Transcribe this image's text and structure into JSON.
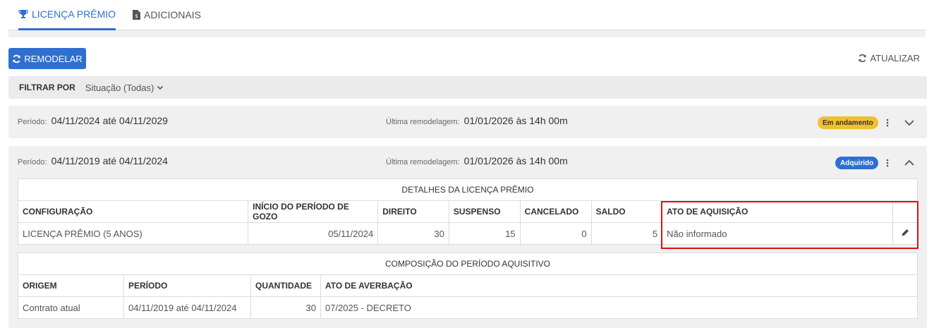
{
  "tabs": [
    {
      "label": "LICENÇA PRÊMIO",
      "icon": "trophy-icon",
      "active": true
    },
    {
      "label": "ADICIONAIS",
      "icon": "document-money-icon",
      "active": false
    }
  ],
  "toolbar": {
    "remodel_label": "REMODELAR",
    "refresh_label": "ATUALIZAR"
  },
  "filter": {
    "label": "FILTRAR POR",
    "value": "Situação (Todas)"
  },
  "periods": [
    {
      "period_label": "Período:",
      "period_value": "04/11/2024 até 04/11/2029",
      "remodel_label": "Última remodelagem:",
      "remodel_value": "01/01/2026 às 14h 00m",
      "status": "Em andamento",
      "status_color": "#f0c030",
      "expanded": false
    },
    {
      "period_label": "Período:",
      "period_value": "04/11/2019 até 04/11/2024",
      "remodel_label": "Última remodelagem:",
      "remodel_value": "01/01/2026 às 14h 00m",
      "status": "Adquirido",
      "status_color": "#2f6fd0",
      "expanded": true,
      "details": {
        "title": "DETALHES DA LICENÇA PRÊMIO",
        "headers": [
          "CONFIGURAÇÃO",
          "INÍCIO DO PERÍODO DE GOZO",
          "DIREITO",
          "SUSPENSO",
          "CANCELADO",
          "SALDO",
          "ATO DE AQUISIÇÃO"
        ],
        "row": [
          "LICENÇA PRÊMIO (5 ANOS)",
          "05/11/2024",
          "30",
          "15",
          "0",
          "5",
          "Não informado"
        ]
      },
      "composition": {
        "title": "COMPOSIÇÃO DO PERÍODO AQUISITIVO",
        "headers": [
          "ORIGEM",
          "PERÍODO",
          "QUANTIDADE",
          "ATO DE AVERBAÇÃO"
        ],
        "row": [
          "Contrato atual",
          "04/11/2019 até 04/11/2024",
          "30",
          "07/2025 - DECRETO"
        ]
      }
    }
  ]
}
